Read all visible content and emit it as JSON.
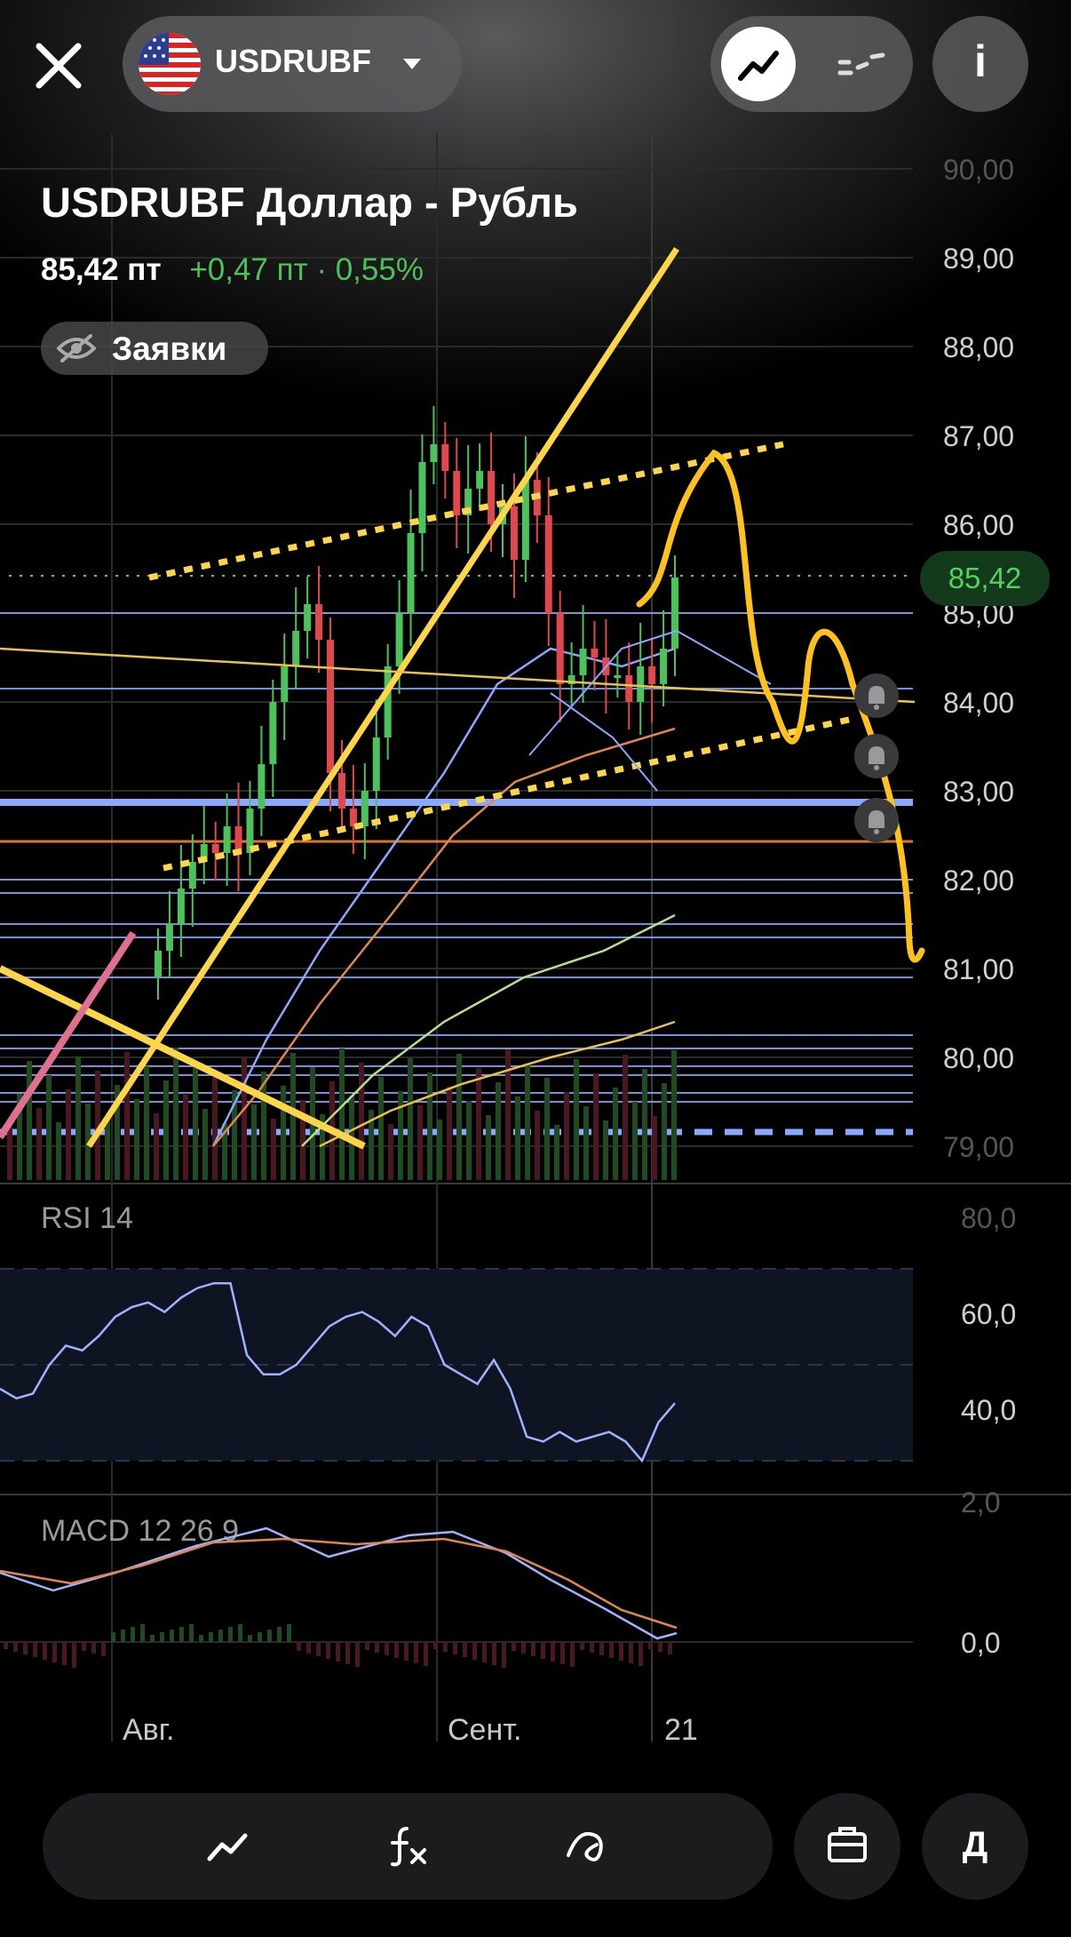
{
  "header": {
    "ticker": "USDRUBF",
    "flag_icon": "us-flag-icon"
  },
  "instrument": {
    "title": "USDRUBF Доллар - Рубль",
    "price": "85,42 пт",
    "change": "+0,47 пт · 0,55%",
    "orders_chip": "Заявки"
  },
  "colors": {
    "up": "#4cc25a",
    "down": "#e0484d",
    "accent_yellow": "#ffd54a",
    "level_blue": "#8aa8ff",
    "current_price_green": "#55d060"
  },
  "price_panel": {
    "y_ticks": [
      "90,00",
      "89,00",
      "88,00",
      "87,00",
      "86,00",
      "85,00",
      "84,00",
      "83,00",
      "82,00",
      "81,00",
      "80,00",
      "79,00"
    ],
    "current_price_badge": "85,42",
    "current_price_value": 85.42
  },
  "rsi_panel": {
    "label": "RSI 14",
    "y_ticks": [
      "80,0",
      "60,0",
      "40,0"
    ]
  },
  "macd_panel": {
    "label": "MACD 12 26 9",
    "y_ticks": [
      "2,0",
      "0,0"
    ]
  },
  "x_axis": {
    "labels": [
      "Авг.",
      "Сент.",
      "21"
    ]
  },
  "chart_data": {
    "type": "candlestick",
    "y_axis_range": [
      79,
      90
    ],
    "close_series": [
      81.2,
      81.5,
      81.9,
      82.2,
      82.4,
      82.3,
      82.6,
      82.3,
      82.8,
      83.3,
      84.0,
      84.4,
      84.8,
      85.1,
      84.7,
      83.2,
      82.8,
      82.6,
      83.0,
      83.6,
      84.4,
      85.0,
      85.9,
      86.7,
      86.9,
      86.6,
      86.1,
      86.4,
      86.6,
      86.0,
      86.2,
      85.6,
      86.5,
      86.1,
      85.0,
      84.2,
      84.3,
      84.6,
      84.5,
      84.3,
      84.3,
      84.0,
      84.4,
      84.2,
      84.6,
      85.4
    ],
    "rsi_series": [
      55,
      53,
      54,
      60,
      64,
      63,
      66,
      70,
      72,
      73,
      71,
      74,
      76,
      77,
      77,
      62,
      58,
      58,
      60,
      64,
      68,
      70,
      71,
      69,
      66,
      70,
      68,
      60,
      58,
      56,
      61,
      55,
      45,
      44,
      46,
      44,
      45,
      46,
      44,
      40,
      48,
      52
    ]
  },
  "toolbar": {
    "tools": [
      "chart-style-icon",
      "indicators-icon",
      "drawing-icon"
    ],
    "portfolio_icon": "briefcase-icon",
    "period_label": "Д"
  }
}
